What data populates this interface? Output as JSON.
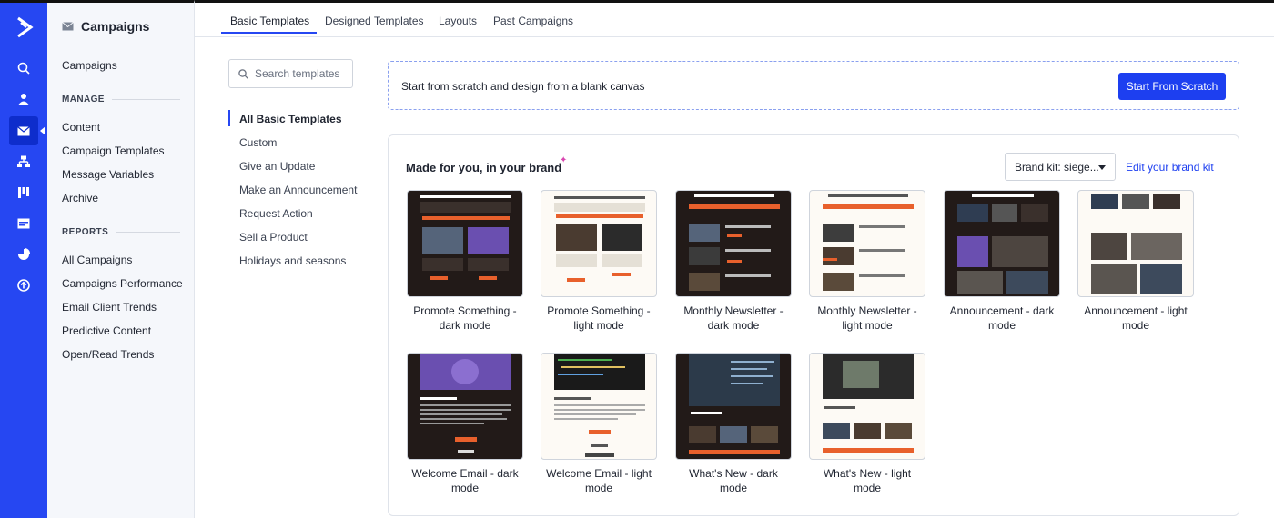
{
  "sidebar": {
    "title": "Campaigns",
    "top_item": "Campaigns",
    "manage_label": "MANAGE",
    "manage_items": [
      "Content",
      "Campaign Templates",
      "Message Variables",
      "Archive"
    ],
    "reports_label": "REPORTS",
    "reports_items": [
      "All Campaigns",
      "Campaigns Performance",
      "Email Client Trends",
      "Predictive Content",
      "Open/Read Trends"
    ]
  },
  "tabs": [
    "Basic Templates",
    "Designed Templates",
    "Layouts",
    "Past Campaigns"
  ],
  "search": {
    "placeholder": "Search templates"
  },
  "categories": [
    "All Basic Templates",
    "Custom",
    "Give an Update",
    "Make an Announcement",
    "Request Action",
    "Sell a Product",
    "Holidays and seasons"
  ],
  "scratch": {
    "text": "Start from scratch and design from a blank canvas",
    "button": "Start From Scratch"
  },
  "panel": {
    "title": "Made for you, in your brand",
    "brand_kit": "Brand kit: siege...",
    "edit_link": "Edit your brand kit"
  },
  "templates": [
    {
      "line1": "Promote Something -",
      "line2": "dark mode",
      "mode": "dark"
    },
    {
      "line1": "Promote Something -",
      "line2": "light mode",
      "mode": "light"
    },
    {
      "line1": "Monthly Newsletter -",
      "line2": "dark mode",
      "mode": "dark"
    },
    {
      "line1": "Monthly Newsletter -",
      "line2": "light mode",
      "mode": "light"
    },
    {
      "line1": "Announcement - dark",
      "line2": "mode",
      "mode": "dark"
    },
    {
      "line1": "Announcement - light",
      "line2": "mode",
      "mode": "light"
    },
    {
      "line1": "Welcome Email - dark",
      "line2": "mode",
      "mode": "dark"
    },
    {
      "line1": "Welcome Email - light",
      "line2": "mode",
      "mode": "light"
    },
    {
      "line1": "What's New - dark mode",
      "line2": "",
      "mode": "dark"
    },
    {
      "line1": "What's New - light mode",
      "line2": "",
      "mode": "light"
    }
  ],
  "colors": {
    "rail": "#2647f2",
    "accent": "#1d3ff0",
    "orange": "#e8602c"
  }
}
